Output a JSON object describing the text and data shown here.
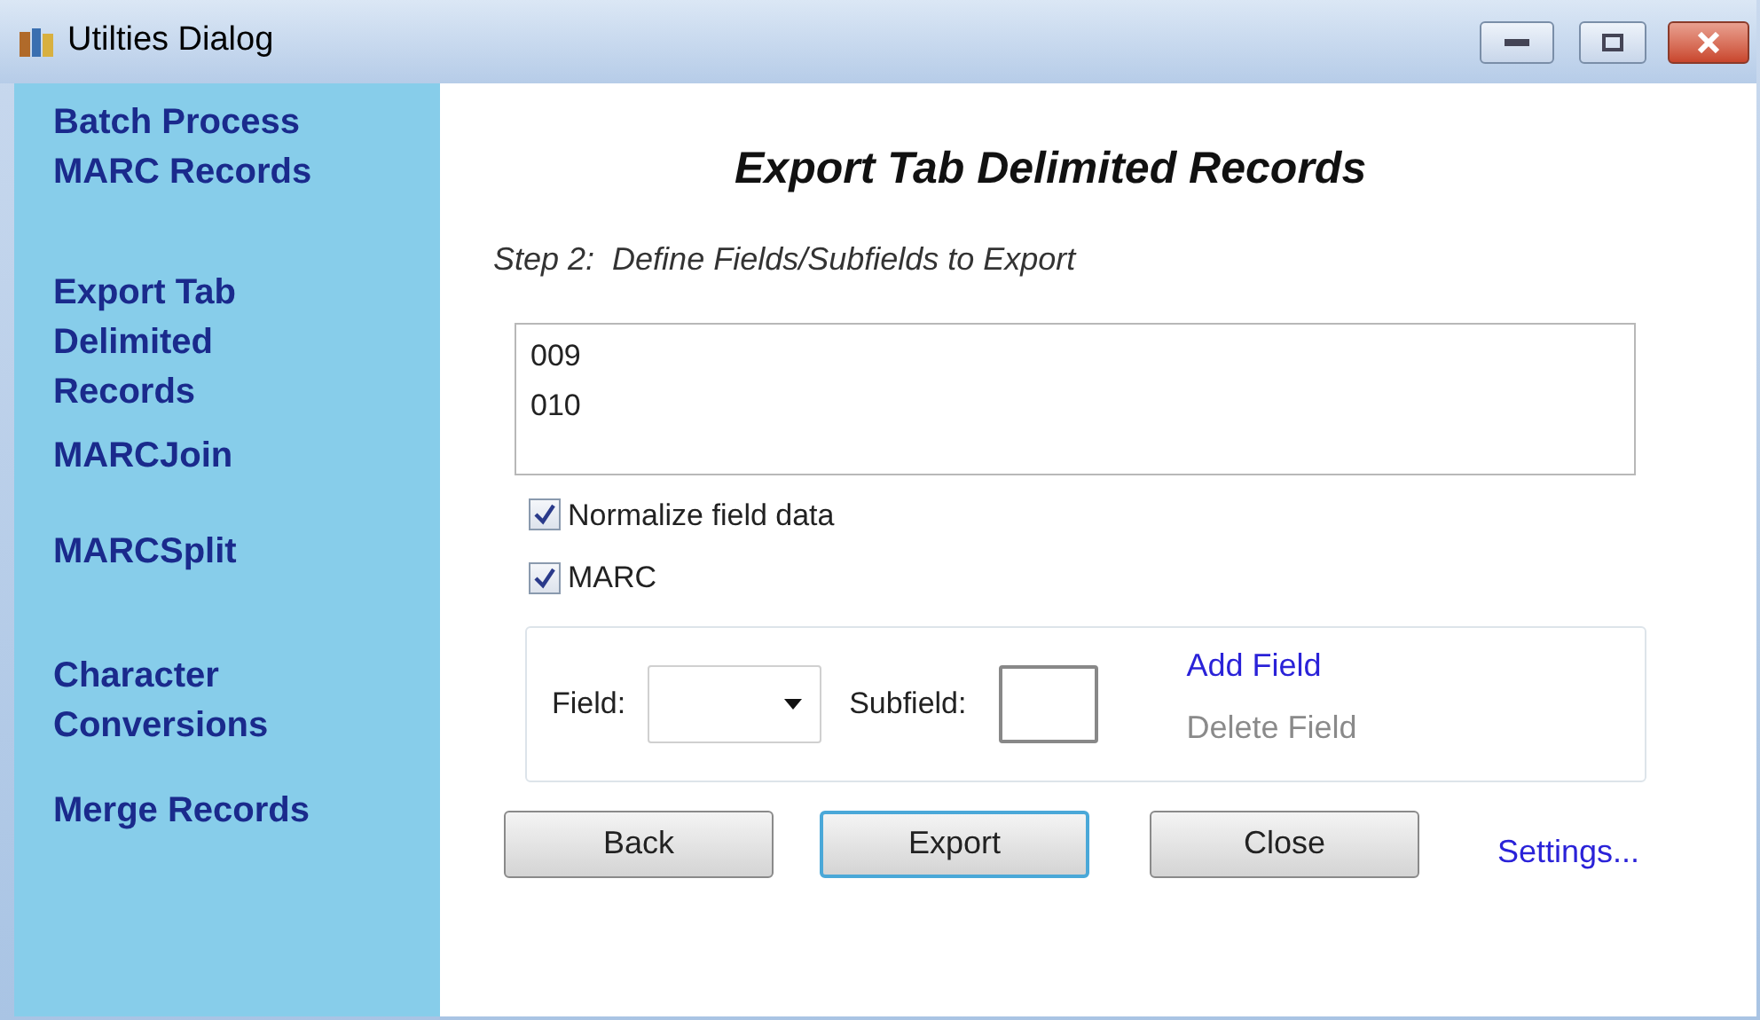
{
  "window": {
    "title": "Utilties Dialog"
  },
  "sidebar": {
    "items": [
      {
        "label": "Batch Process MARC Records"
      },
      {
        "label": "Export Tab Delimited Records"
      },
      {
        "label": "MARCJoin"
      },
      {
        "label": "MARCSplit"
      },
      {
        "label": "Character Conversions"
      },
      {
        "label": "Merge Records"
      }
    ]
  },
  "heading": "Export Tab Delimited Records",
  "step": "Step 2:  Define Fields/Subfields to Export",
  "field_list": [
    "009",
    "010"
  ],
  "checkboxes": [
    {
      "label": "Normalize field data",
      "checked": true
    },
    {
      "label": "MARC",
      "checked": true
    }
  ],
  "field_label": "Field:",
  "subfield_label": "Subfield:",
  "links": [
    {
      "label": "Add Field",
      "disabled": false
    },
    {
      "label": "Delete Field",
      "disabled": true
    }
  ],
  "buttons": [
    {
      "label": "Back",
      "focused": false
    },
    {
      "label": "Export",
      "focused": true
    },
    {
      "label": "Close",
      "focused": false
    }
  ],
  "settings_link": "Settings..."
}
